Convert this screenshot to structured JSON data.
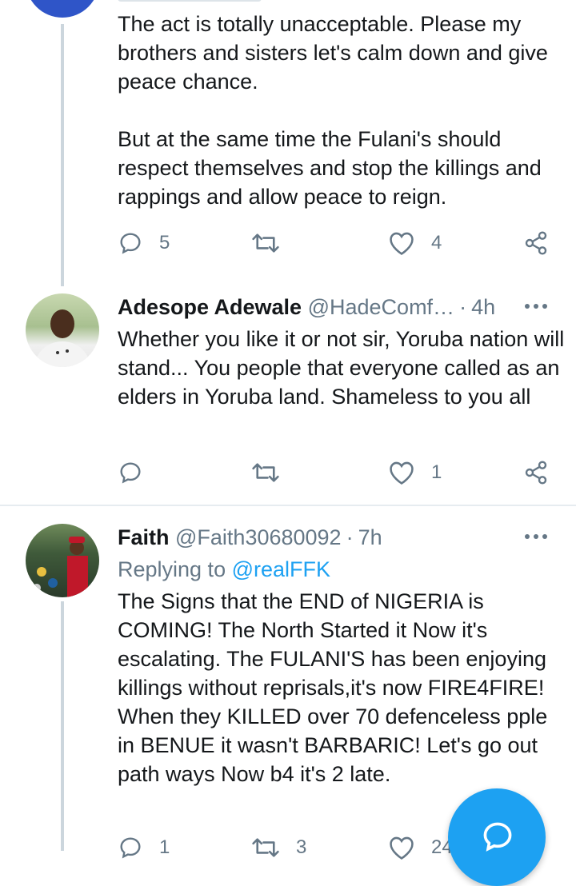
{
  "tweets": [
    {
      "text": "The act is totally unacceptable. Please my brothers and sisters let's calm down and give peace chance.\n\nBut at the same time the Fulani's should respect themselves and stop the killings and rappings and allow peace to reign.",
      "replies": "5",
      "retweets": "",
      "likes": "4"
    },
    {
      "name": "Adesope Adewale",
      "handle": "@HadeComf…",
      "time": "4h",
      "text": "Whether you like it or not sir, Yoruba nation will stand... You people that everyone called as an elders in Yoruba land. Shameless to you all",
      "replies": "",
      "retweets": "",
      "likes": "1"
    },
    {
      "name": "Faith",
      "handle": "@Faith30680092",
      "time": "7h",
      "replying_label": "Replying to",
      "replying_to": "@realFFK",
      "text": "The Signs that the END of NIGERIA is COMING! The North Started it Now it's escalating. The FULANI'S has been enjoying killings without reprisals,it's now FIRE4FIRE! When they KILLED over 70 defenceless pple in BENUE it wasn't BARBARIC! Let's go out path ways Now b4 it's 2 late.",
      "replies": "1",
      "retweets": "3",
      "likes": "24"
    }
  ],
  "separator": "·",
  "colors": {
    "accent": "#1da1f2",
    "muted": "#657786",
    "text": "#14171a",
    "line": "#ccd6dd"
  },
  "fab_icon": "compose-reply-icon"
}
